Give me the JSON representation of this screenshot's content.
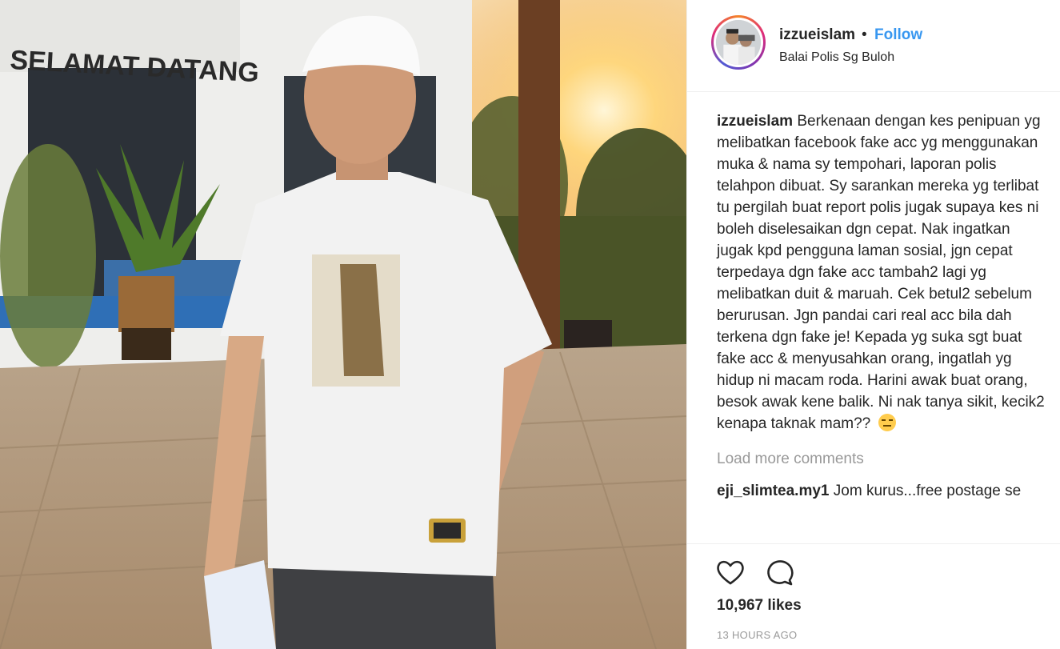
{
  "post": {
    "username": "izzueislam",
    "separator": "•",
    "follow_label": "Follow",
    "location": "Balai Polis Sg Buloh",
    "photo_sign_text": "SELAMAT DATANG",
    "caption_username": "izzueislam",
    "caption_text": "Berkenaan dengan kes penipuan yg melibatkan facebook fake acc yg menggunakan muka & nama sy tempohari, laporan polis telahpon dibuat. Sy sarankan mereka yg terlibat tu pergilah buat report polis jugak supaya kes ni boleh diselesaikan dgn cepat. Nak ingatkan jugak kpd pengguna laman sosial, jgn cepat terpedaya dgn fake acc tambah2 lagi yg melibatkan duit & maruah. Cek betul2 sebelum berurusan. Jgn pandai cari real acc bila dah terkena dgn fake je! Kepada yg suka sgt buat fake acc & menyusahkan orang, ingatlah yg hidup ni macam roda. Harini awak buat orang, besok awak kene balik. Ni nak tanya sikit, kecik2 kenapa taknak mam??",
    "caption_emoji": "expressionless-face-emoji",
    "load_more_label": "Load more comments",
    "comments": [
      {
        "username": "eji_slimtea.my1",
        "text": "Jom kurus...free postage se"
      }
    ],
    "likes_label": "10,967 likes",
    "time_label": "13 HOURS AGO",
    "icons": [
      "heart-icon",
      "comment-icon"
    ],
    "colors": {
      "accent": "#3897f0",
      "muted": "#999999",
      "text": "#262626"
    }
  }
}
